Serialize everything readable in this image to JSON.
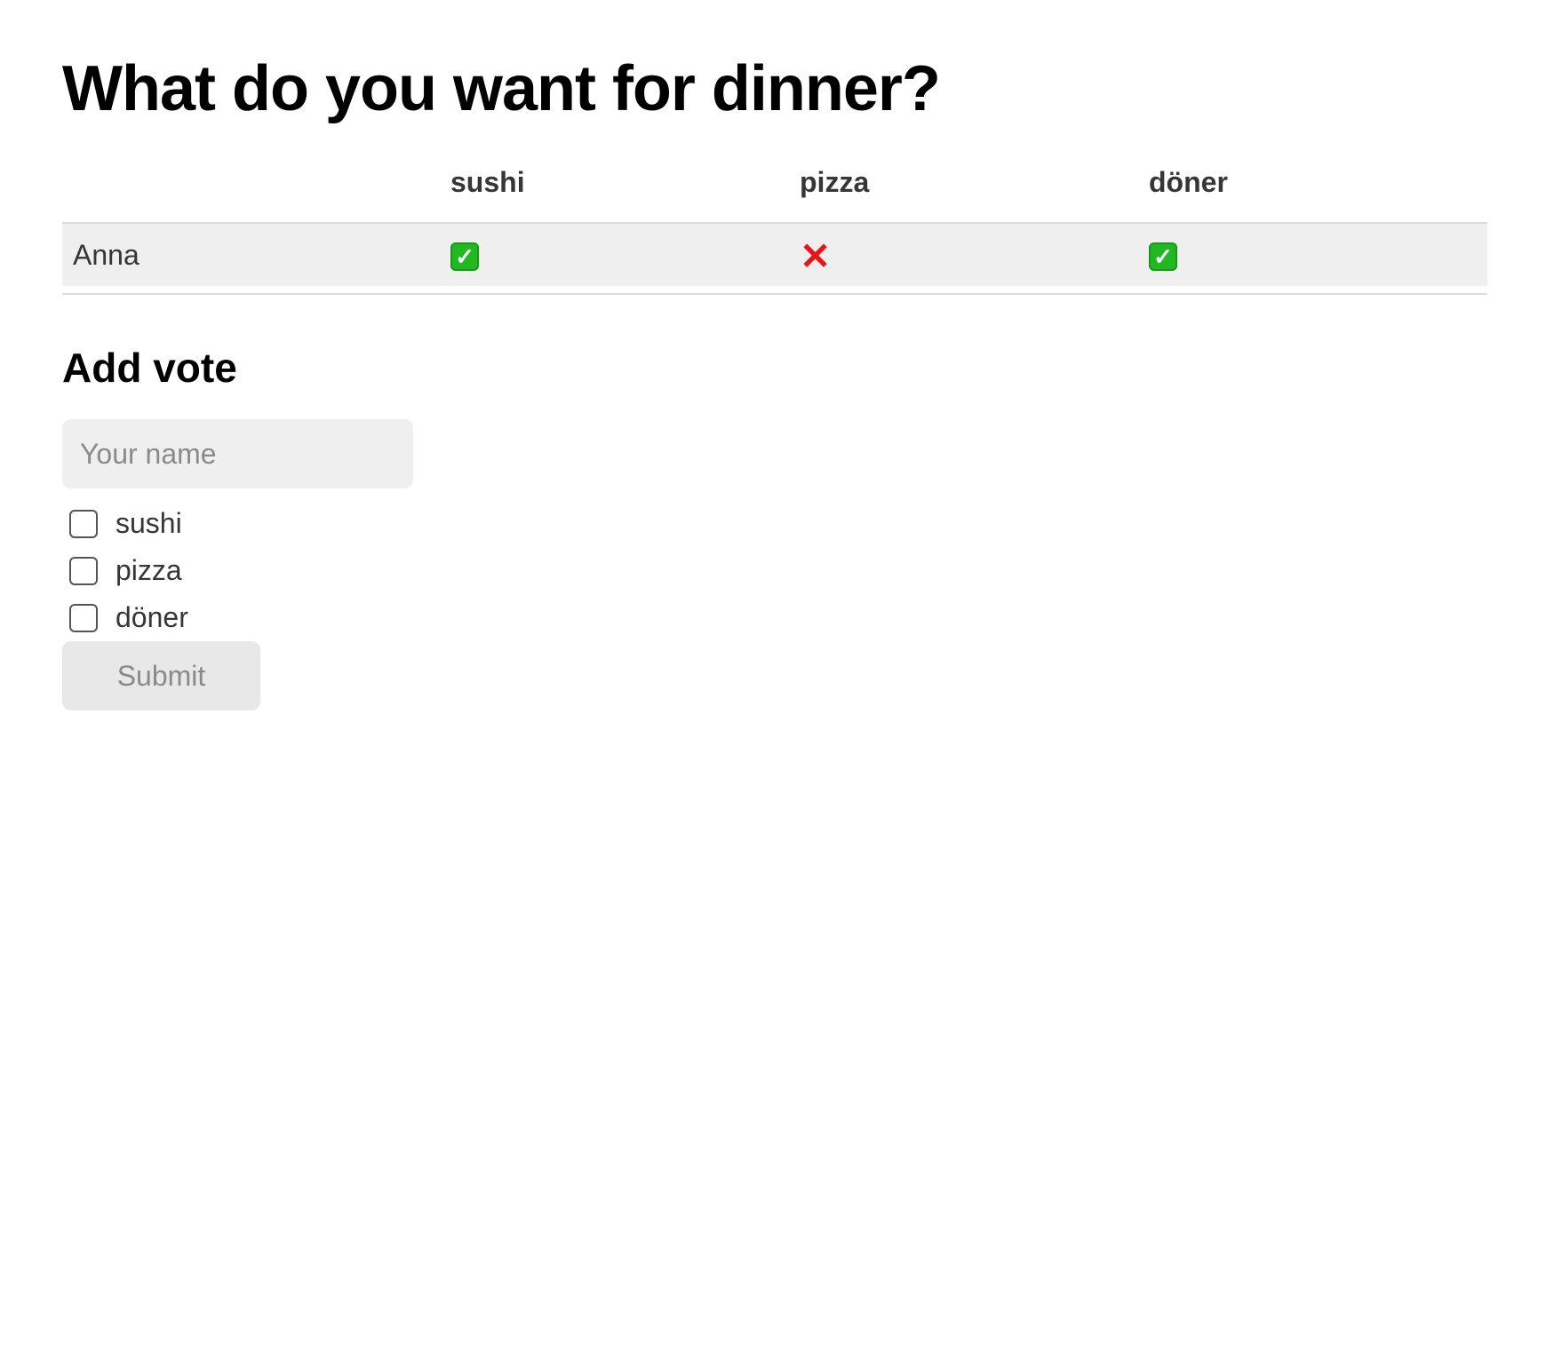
{
  "title": "What do you want for dinner?",
  "table": {
    "headers": [
      "",
      "sushi",
      "pizza",
      "döner"
    ],
    "rows": [
      {
        "name": "Anna",
        "votes": [
          "✓",
          "✕",
          "✓"
        ]
      }
    ]
  },
  "add_vote": {
    "heading": "Add vote",
    "name_placeholder": "Your name",
    "options": [
      "sushi",
      "pizza",
      "döner"
    ],
    "submit_label": "Submit"
  },
  "colors": {
    "yes": "#22b822",
    "no": "#e8141a",
    "row_background": "#efefef"
  }
}
